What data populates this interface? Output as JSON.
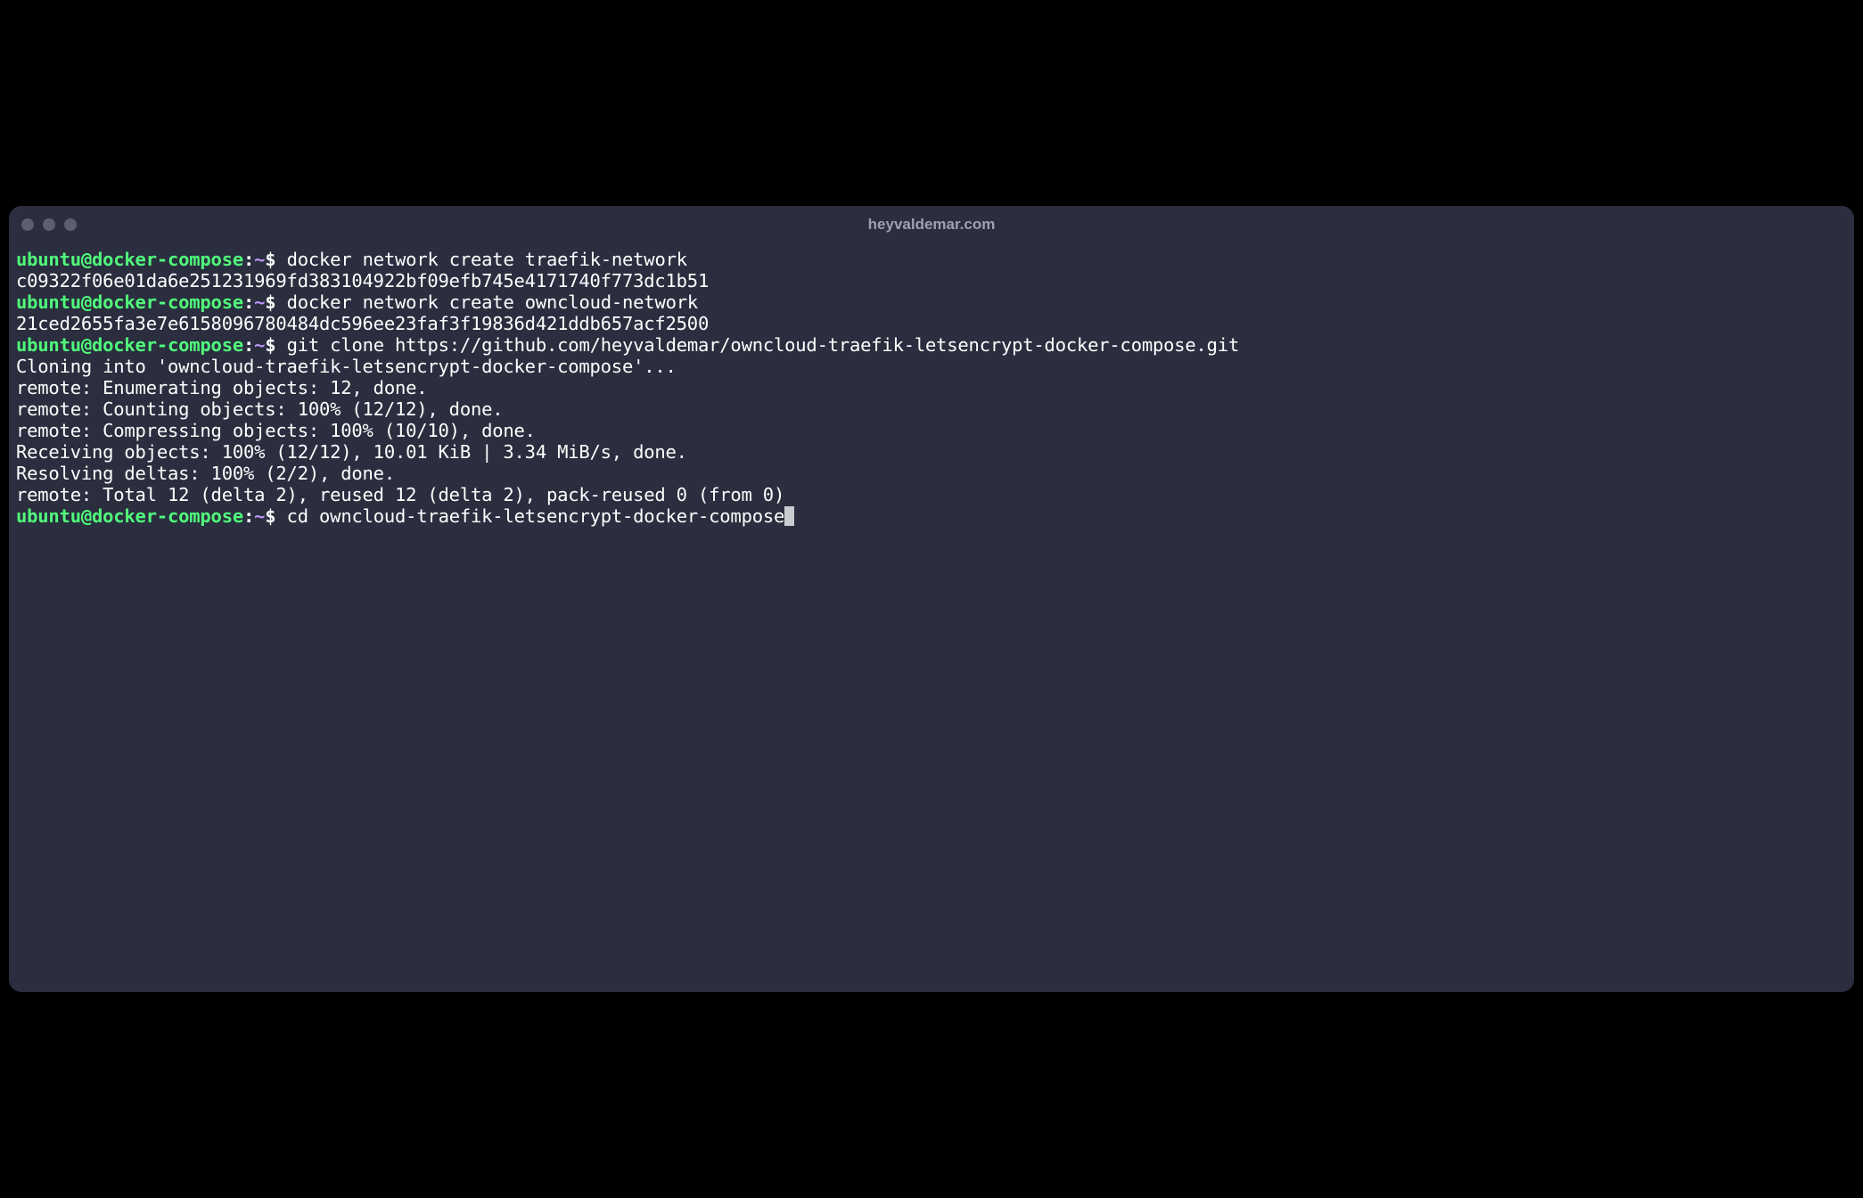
{
  "window": {
    "title": "heyvaldemar.com"
  },
  "prompt": {
    "user_host": "ubuntu@docker-compose",
    "colon": ":",
    "path": "~",
    "symbol": "$"
  },
  "lines": {
    "l0_cmd": "docker network create traefik-network",
    "l1_out": "c09322f06e01da6e251231969fd383104922bf09efb745e4171740f773dc1b51",
    "l2_cmd": "docker network create owncloud-network",
    "l3_out": "21ced2655fa3e7e6158096780484dc596ee23faf3f19836d421ddb657acf2500",
    "l4_cmd": "git clone https://github.com/heyvaldemar/owncloud-traefik-letsencrypt-docker-compose.git",
    "l5_out": "Cloning into 'owncloud-traefik-letsencrypt-docker-compose'...",
    "l6_out": "remote: Enumerating objects: 12, done.",
    "l7_out": "remote: Counting objects: 100% (12/12), done.",
    "l8_out": "remote: Compressing objects: 100% (10/10), done.",
    "l9_out": "Receiving objects: 100% (12/12), 10.01 KiB | 3.34 MiB/s, done.",
    "l10_out": "Resolving deltas: 100% (2/2), done.",
    "l11_out": "remote: Total 12 (delta 2), reused 12 (delta 2), pack-reused 0 (from 0)",
    "l12_cmd": "cd owncloud-traefik-letsencrypt-docker-compose"
  }
}
